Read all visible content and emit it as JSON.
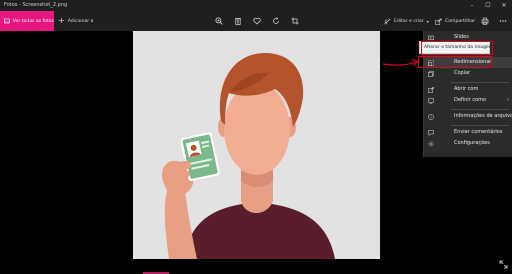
{
  "window": {
    "title": "Fotos - Screenshot_2.png"
  },
  "toolbar": {
    "see_all_label": "Ver todas as fotos",
    "add_label": "Adicionar a",
    "edit_label": "Editar e criar",
    "share_label": "Compartilhar"
  },
  "tooltip": {
    "text": "Alterar o tamanho da imagem"
  },
  "menu": {
    "items": [
      {
        "label": "Slides",
        "icon": "slideshow-icon"
      },
      {
        "label": "Redimensionar",
        "icon": "resize-icon"
      },
      {
        "label": "Copiar",
        "icon": "copy-icon"
      },
      {
        "label": "Abrir com",
        "icon": "open-with-icon"
      },
      {
        "label": "Definir como",
        "icon": "set-as-icon",
        "chevron": "›"
      },
      {
        "label": "Informações de arquivo",
        "icon": "info-icon"
      },
      {
        "label": "Enviar comentários",
        "icon": "feedback-icon"
      },
      {
        "label": "Configurações",
        "icon": "settings-icon"
      }
    ]
  },
  "colors": {
    "accent": "#e8177f",
    "highlight": "#e0001b",
    "photo_bg": "#e2e2e2"
  }
}
